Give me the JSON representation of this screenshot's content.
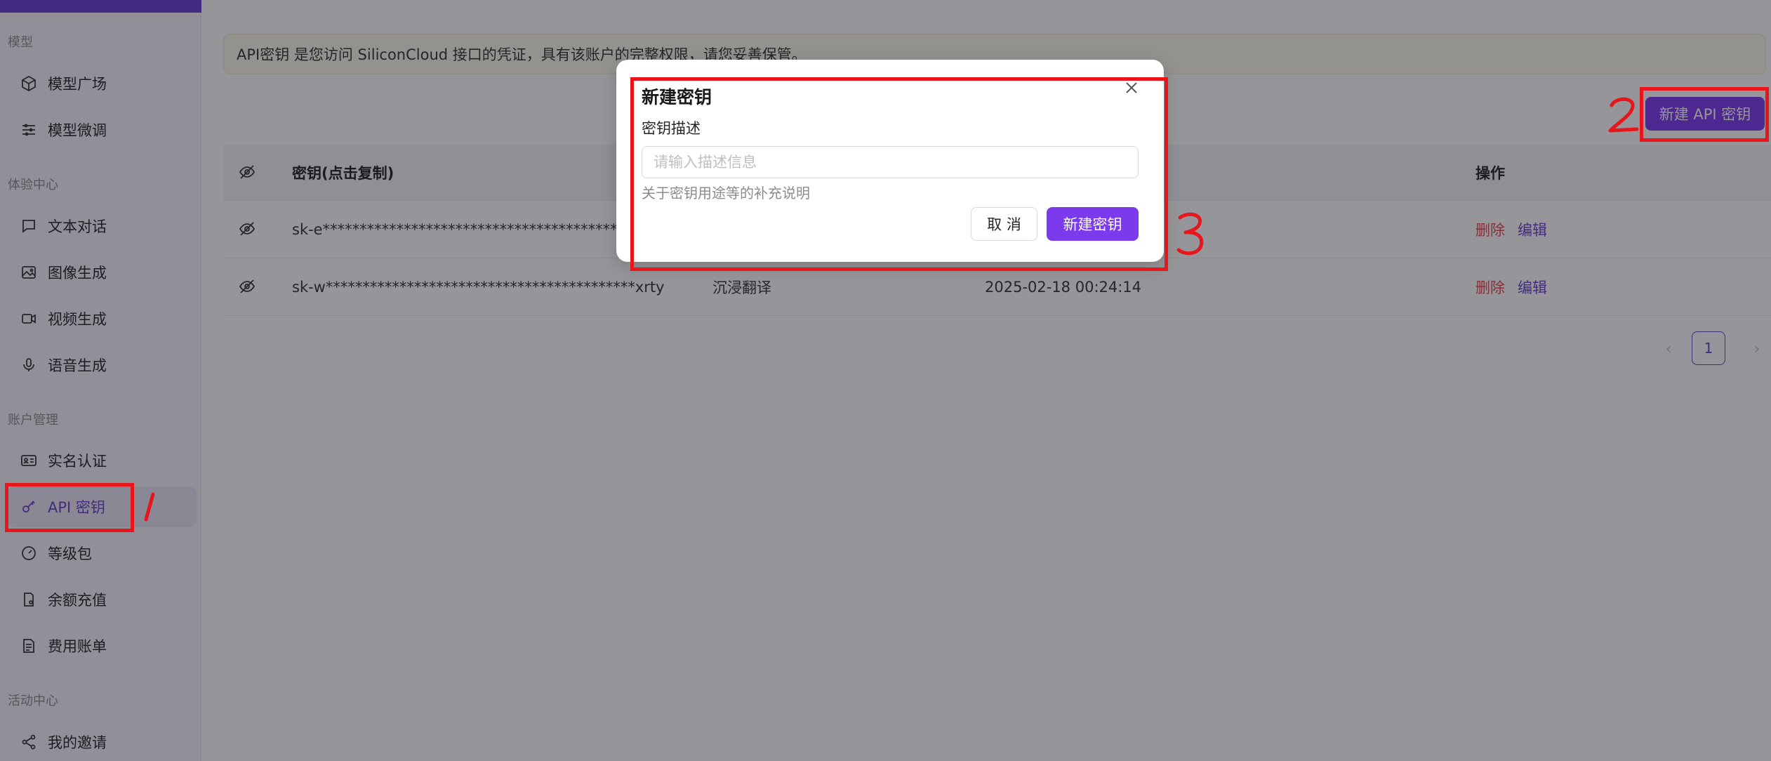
{
  "sidebar": {
    "sections": {
      "models": "模型",
      "experience": "体验中心",
      "account": "账户管理",
      "activity": "活动中心"
    },
    "items": [
      {
        "label": "模型广场",
        "icon": "cube-icon"
      },
      {
        "label": "模型微调",
        "icon": "sliders-icon"
      },
      {
        "label": "文本对话",
        "icon": "chat-icon"
      },
      {
        "label": "图像生成",
        "icon": "image-icon"
      },
      {
        "label": "视频生成",
        "icon": "video-icon"
      },
      {
        "label": "语音生成",
        "icon": "microphone-icon"
      },
      {
        "label": "实名认证",
        "icon": "id-card-icon"
      },
      {
        "label": "API 密钥",
        "icon": "key-icon",
        "active": true
      },
      {
        "label": "等级包",
        "icon": "gauge-icon"
      },
      {
        "label": "余额充值",
        "icon": "wallet-icon"
      },
      {
        "label": "费用账单",
        "icon": "bill-icon"
      },
      {
        "label": "我的邀请",
        "icon": "share-icon"
      }
    ]
  },
  "notice": "API密钥 是您访问 SiliconCloud 接口的凭证，具有该账户的完整权限，请您妥善保管。",
  "toolbar": {
    "new_key_label": "新建 API 密钥"
  },
  "table": {
    "headers": {
      "key": "密钥(点击复制)",
      "ops": "操作"
    },
    "rows": [
      {
        "key": "sk-e******************************************gwkb",
        "description": "",
        "created": "",
        "delete": "删除",
        "edit": "编辑"
      },
      {
        "key": "sk-w******************************************xrty",
        "description": "沉浸翻译",
        "created": "2025-02-18 00:24:14",
        "delete": "删除",
        "edit": "编辑"
      }
    ]
  },
  "pagination": {
    "current": "1",
    "prev": "‹",
    "next": "›"
  },
  "modal": {
    "title": "新建密钥",
    "field_label": "密钥描述",
    "placeholder": "请输入描述信息",
    "help": "关于密钥用途等的补充说明",
    "cancel": "取 消",
    "submit": "新建密钥"
  },
  "annotations": [
    "1",
    "2",
    "3"
  ],
  "colors": {
    "accent": "#7c3aed",
    "annotation": "#e8151b",
    "danger": "#e5484d"
  }
}
